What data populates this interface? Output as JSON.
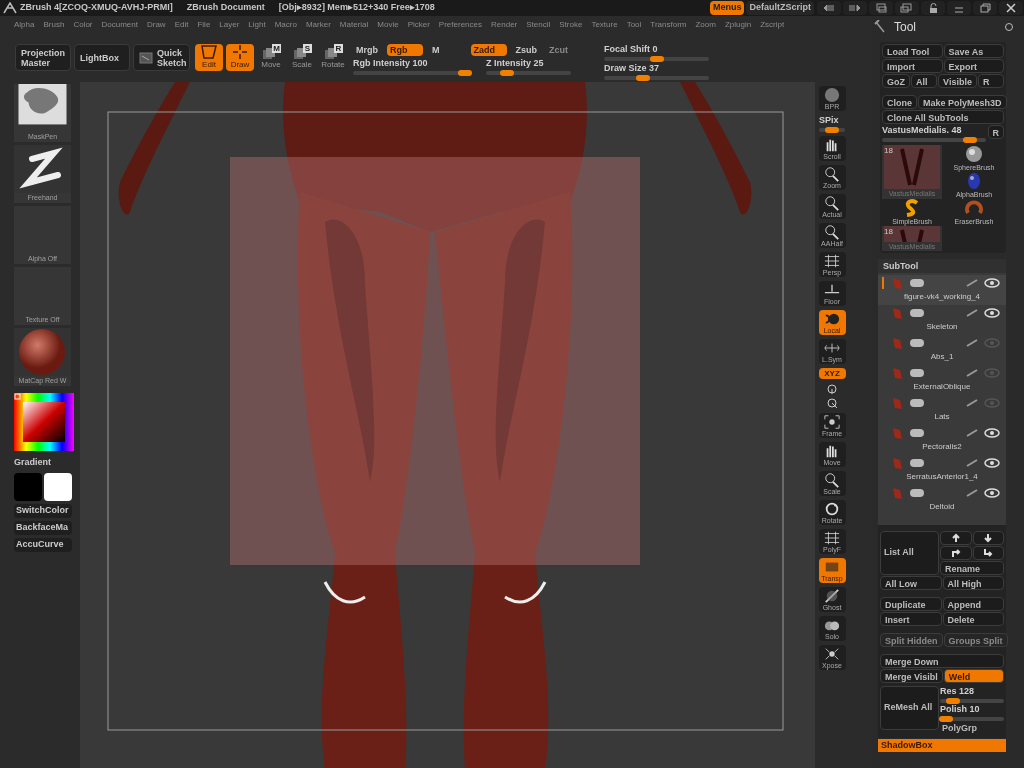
{
  "title_bar": {
    "app_title": "ZBrush 4[ZCOQ-XMUQ-AVHJ-PRMI]",
    "document_title": "ZBrush Document",
    "stats": "[Obj▸8932] Mem▸512+340 Free▸1708",
    "buttons": [
      {
        "label": "Menus",
        "selected": true
      },
      {
        "label": "DefaultZScript",
        "selected": false
      }
    ]
  },
  "menu_bar": {
    "items": [
      "Alpha",
      "Brush",
      "Color",
      "Document",
      "Draw",
      "Edit",
      "File",
      "Layer",
      "Light",
      "Macro",
      "Marker",
      "Material",
      "Movie",
      "Picker",
      "Preferences",
      "Render",
      "Stencil",
      "Stroke",
      "Texture",
      "Tool",
      "Transform",
      "Zoom",
      "Zplugin",
      "Zscript"
    ]
  },
  "toolbar": {
    "buttons": [
      {
        "label": "Projection Master",
        "kind": "text"
      },
      {
        "label": "LightBox",
        "kind": "text"
      },
      {
        "label": "Quick Sketch",
        "kind": "sketch"
      }
    ],
    "modes": [
      {
        "label": "Edit",
        "active": true
      },
      {
        "label": "Draw",
        "active": true
      },
      {
        "label": "Move",
        "key": "M",
        "active": false
      },
      {
        "label": "Scale",
        "key": "S",
        "active": false
      },
      {
        "label": "Rotate",
        "key": "R",
        "active": false
      }
    ],
    "rgb_toggles": [
      {
        "label": "Mrgb",
        "selected": false
      },
      {
        "label": "Rgb",
        "selected": true
      },
      {
        "label": "M",
        "selected": false
      }
    ],
    "rgb_intensity": {
      "label": "Rgb Intensity 100",
      "level": 0.95
    },
    "z_toggles": [
      {
        "label": "Zadd",
        "selected": true
      },
      {
        "label": "Zsub",
        "selected": false
      },
      {
        "label": "Zcut",
        "selected": false,
        "disabled": true
      }
    ],
    "z_intensity": {
      "label": "Z Intensity 25",
      "level": 0.25
    },
    "focal_shift": {
      "label": "Focal Shift 0",
      "level": 0.5
    },
    "draw_size": {
      "label": "Draw Size 37",
      "level": 0.37
    }
  },
  "left_shelf": {
    "thumbnails": [
      {
        "label": "MaskPen",
        "kind": "brush"
      },
      {
        "label": "Freehand",
        "kind": "stroke"
      },
      {
        "label": "Alpha Off",
        "kind": "empty"
      },
      {
        "label": "Texture Off",
        "kind": "empty"
      },
      {
        "label": "MatCap Red W",
        "kind": "material"
      }
    ],
    "gradient_label": "Gradient",
    "buttons": [
      "SwitchColor",
      "BackfaceMa",
      "AccuCurve"
    ]
  },
  "right_shelf": {
    "items": [
      {
        "label": "BPR",
        "kind": "button",
        "active": false
      },
      {
        "label": "SPix",
        "kind": "slider",
        "level": 0.5
      },
      {
        "label": "Scroll",
        "kind": "button",
        "active": false
      },
      {
        "label": "Zoom",
        "kind": "button",
        "active": false
      },
      {
        "label": "Actual",
        "kind": "button",
        "active": false
      },
      {
        "label": "AAHalf",
        "kind": "button",
        "active": false
      },
      {
        "label": "Persp",
        "kind": "button",
        "active": false
      },
      {
        "label": "Floor",
        "kind": "button",
        "active": false
      },
      {
        "label": "Local",
        "kind": "button",
        "active": true
      },
      {
        "label": "L.Sym",
        "kind": "button",
        "active": false
      },
      {
        "label": "XYZ",
        "kind": "small",
        "active": true
      },
      {
        "kind": "rotate"
      },
      {
        "label": "Frame",
        "kind": "button",
        "active": false
      },
      {
        "label": "Move",
        "kind": "button",
        "active": false
      },
      {
        "label": "Scale",
        "kind": "button",
        "active": false
      },
      {
        "label": "Rotate",
        "kind": "button",
        "active": false
      },
      {
        "label": "PolyF",
        "kind": "button",
        "active": false
      },
      {
        "label": "Transp",
        "kind": "button",
        "active": true
      },
      {
        "label": "Ghost",
        "kind": "button",
        "active": false
      },
      {
        "label": "Solo",
        "kind": "button",
        "active": false
      },
      {
        "label": "Xpose",
        "kind": "button",
        "active": false
      }
    ]
  },
  "tool_panel": {
    "title": "Tool",
    "rows": [
      [
        "Load Tool",
        "Save As"
      ],
      [
        "Import",
        "Export"
      ],
      [
        "GoZ",
        "All",
        "Visible",
        "R"
      ]
    ],
    "rows2": [
      [
        "Clone",
        "Make PolyMesh3D"
      ],
      [
        "Clone All SubTools"
      ]
    ],
    "tool_slider": {
      "label": "VastusMedialis. 48",
      "level": 0.85,
      "button": "R"
    },
    "thumbnails": [
      {
        "label": "VastusMedialis",
        "count": "18",
        "kind": "mesh"
      },
      {
        "label": "SphereBrush",
        "kind": "sphere"
      },
      {
        "label": "AlphaBrush",
        "kind": "alpha"
      },
      {
        "label": "SimpleBrush",
        "kind": "simple"
      },
      {
        "label": "EraserBrush",
        "kind": "eraser"
      },
      {
        "label": "VastusMedialis",
        "count": "18",
        "kind": "mesh"
      }
    ],
    "subtool": {
      "title": "SubTool",
      "items": [
        {
          "name": "figure-vk4_working_4",
          "visible": true,
          "selected": true
        },
        {
          "name": "Skeleton",
          "visible": true,
          "selected": false
        },
        {
          "name": "Abs_1",
          "visible": false,
          "selected": false
        },
        {
          "name": "ExternalOblique",
          "visible": false,
          "selected": false
        },
        {
          "name": "Lats",
          "visible": false,
          "selected": false
        },
        {
          "name": "Pectoralis2",
          "visible": true,
          "selected": false
        },
        {
          "name": "SerratusAnterior1_4",
          "visible": true,
          "selected": false
        },
        {
          "name": "Deltoid",
          "visible": true,
          "selected": false
        }
      ],
      "list_all": "List All",
      "rename": "Rename",
      "pairs": [
        [
          "All Low",
          "All High"
        ],
        [
          "Duplicate",
          "Append"
        ],
        [
          "Insert",
          "Delete"
        ]
      ],
      "disabled_pair": [
        "Split Hidden",
        "Groups Split"
      ],
      "merge_down": "Merge Down",
      "merge_visible": "Merge Visibl",
      "weld": {
        "label": "Weld",
        "on": true
      },
      "remesh_all": "ReMesh All",
      "res": {
        "label": "Res 128",
        "level": 0.2
      },
      "polish": {
        "label": "Polish 10",
        "level": 0.1
      },
      "polygrp": "PolyGrp"
    },
    "shadowbox": "ShadowBox"
  }
}
